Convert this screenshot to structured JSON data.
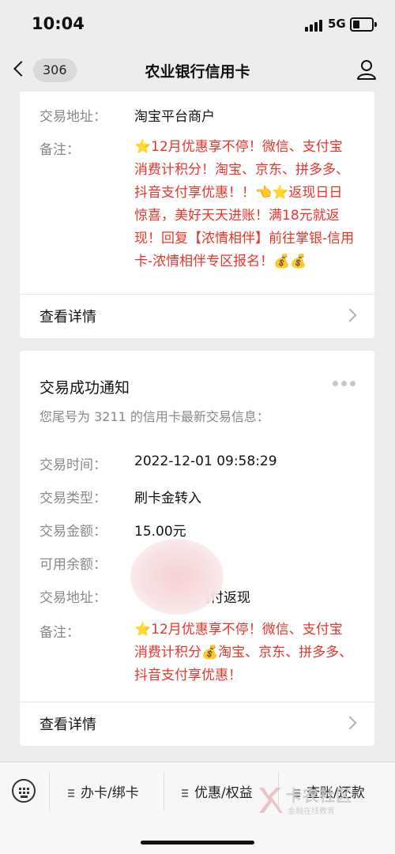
{
  "status": {
    "time": "10:04",
    "network": "5G"
  },
  "nav": {
    "unread_count": "306",
    "title": "农业银行信用卡"
  },
  "card1": {
    "address_label": "交易地址：",
    "address_value": "淘宝平台商户",
    "note_label": "备注：",
    "note_text": "⭐12月优惠享不停！微信、支付宝消费计积分！淘宝、京东、拼多多、抖音支付享优惠！！👈⭐返现日日惊喜，美好天天进账！满18元就返现！回复【浓情相伴】前往掌银-信用卡-浓情相伴专区报名！💰💰",
    "detail_label": "查看详情"
  },
  "card2": {
    "title": "交易成功通知",
    "subtitle": "您尾号为 3211 的信用卡最新交易信息：",
    "rows": [
      {
        "label": "交易时间：",
        "value": "2022-12-01 09:58:29"
      },
      {
        "label": "交易类型：",
        "value": "刷卡金转入"
      },
      {
        "label": "交易金额：",
        "value": "15.00元"
      },
      {
        "label": "可用余额：",
        "value": "元"
      },
      {
        "label": "交易地址：",
        "value": "云闪付返现"
      }
    ],
    "note_label": "备注：",
    "note_text": "⭐12月优惠享不停！微信、支付宝消费计积分💰淘宝、京东、拼多多、抖音支付享优惠！",
    "detail_label": "查看详情"
  },
  "menu": {
    "items": [
      "办卡/绑卡",
      "优惠/权益",
      "查账/还款"
    ]
  },
  "watermark": {
    "title": "卡农社区",
    "subtitle": "金融在线教育"
  }
}
